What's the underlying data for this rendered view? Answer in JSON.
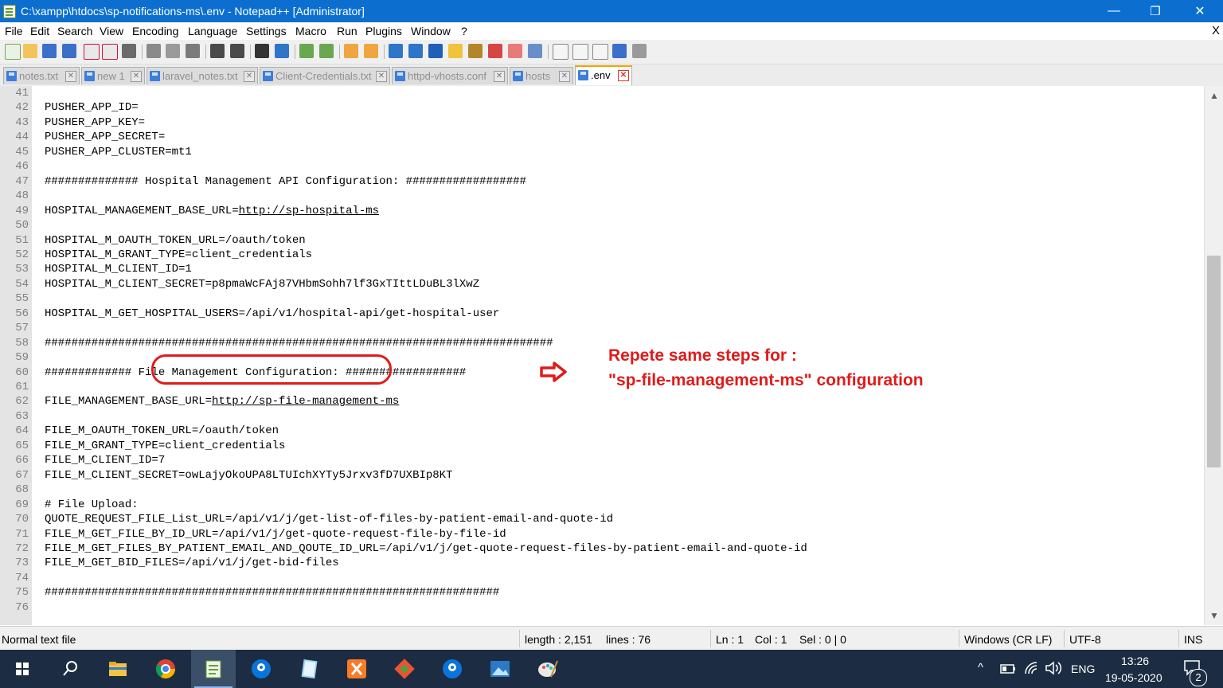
{
  "window": {
    "title": "C:\\xampp\\htdocs\\sp-notifications-ms\\.env - Notepad++ [Administrator]",
    "minimize": "—",
    "maximize": "❐",
    "close": "✕"
  },
  "menu": {
    "items": [
      "File",
      "Edit",
      "Search",
      "View",
      "Encoding",
      "Language",
      "Settings",
      "Macro",
      "Run",
      "Plugins",
      "Window",
      "?"
    ],
    "close_document": "X"
  },
  "tabs": [
    {
      "label": "notes.txt",
      "active": false
    },
    {
      "label": "new 1",
      "active": false
    },
    {
      "label": "laravel_notes.txt",
      "active": false
    },
    {
      "label": "Client-Credentials.txt",
      "active": false
    },
    {
      "label": "httpd-vhosts.conf",
      "active": false
    },
    {
      "label": "hosts",
      "active": false
    },
    {
      "label": ".env",
      "active": true
    }
  ],
  "tab_close_glyph": "✕",
  "editor": {
    "lines": [
      {
        "n": "41",
        "text": ""
      },
      {
        "n": "42",
        "text": "PUSHER_APP_ID="
      },
      {
        "n": "43",
        "text": "PUSHER_APP_KEY="
      },
      {
        "n": "44",
        "text": "PUSHER_APP_SECRET="
      },
      {
        "n": "45",
        "text": "PUSHER_APP_CLUSTER=mt1"
      },
      {
        "n": "46",
        "text": ""
      },
      {
        "n": "47",
        "text": "############## Hospital Management API Configuration: ##################"
      },
      {
        "n": "48",
        "text": ""
      },
      {
        "n": "49",
        "pre": "HOSPITAL_MANAGEMENT_BASE_URL=",
        "url": "http://sp-hospital-ms"
      },
      {
        "n": "50",
        "text": ""
      },
      {
        "n": "51",
        "text": "HOSPITAL_M_OAUTH_TOKEN_URL=/oauth/token"
      },
      {
        "n": "52",
        "text": "HOSPITAL_M_GRANT_TYPE=client_credentials"
      },
      {
        "n": "53",
        "text": "HOSPITAL_M_CLIENT_ID=1"
      },
      {
        "n": "54",
        "text": "HOSPITAL_M_CLIENT_SECRET=p8pmaWcFAj87VHbmSohh7lf3GxTIttLDuBL3lXwZ"
      },
      {
        "n": "55",
        "text": ""
      },
      {
        "n": "56",
        "text": "HOSPITAL_M_GET_HOSPITAL_USERS=/api/v1/hospital-api/get-hospital-user"
      },
      {
        "n": "57",
        "text": ""
      },
      {
        "n": "58",
        "text": "############################################################################"
      },
      {
        "n": "59",
        "text": ""
      },
      {
        "n": "60",
        "text": "############# File Management Configuration: ##################"
      },
      {
        "n": "61",
        "text": ""
      },
      {
        "n": "62",
        "pre": "FILE_MANAGEMENT_BASE_URL=",
        "url": "http://sp-file-management-ms"
      },
      {
        "n": "63",
        "text": ""
      },
      {
        "n": "64",
        "text": "FILE_M_OAUTH_TOKEN_URL=/oauth/token"
      },
      {
        "n": "65",
        "text": "FILE_M_GRANT_TYPE=client_credentials"
      },
      {
        "n": "66",
        "text": "FILE_M_CLIENT_ID=7"
      },
      {
        "n": "67",
        "text": "FILE_M_CLIENT_SECRET=owLajyOkoUPA8LTUIchXYTy5Jrxv3fD7UXBIp8KT"
      },
      {
        "n": "68",
        "text": ""
      },
      {
        "n": "69",
        "text": "# File Upload:"
      },
      {
        "n": "70",
        "text": "QUOTE_REQUEST_FILE_List_URL=/api/v1/j/get-list-of-files-by-patient-email-and-quote-id"
      },
      {
        "n": "71",
        "text": "FILE_M_GET_FILE_BY_ID_URL=/api/v1/j/get-quote-request-file-by-file-id"
      },
      {
        "n": "72",
        "text": "FILE_M_GET_FILES_BY_PATIENT_EMAIL_AND_QOUTE_ID_URL=/api/v1/j/get-quote-request-files-by-patient-email-and-quote-id"
      },
      {
        "n": "73",
        "text": "FILE_M_GET_BID_FILES=/api/v1/j/get-bid-files"
      },
      {
        "n": "74",
        "text": ""
      },
      {
        "n": "75",
        "text": "####################################################################"
      },
      {
        "n": "76",
        "text": ""
      }
    ]
  },
  "annotation": {
    "line1": "Repete same steps for :",
    "line2": "\"sp-file-management-ms\" configuration",
    "color": "#e01b1b"
  },
  "scrollbar": {
    "up": "▲",
    "down": "▼",
    "position": 0.52,
    "visible_fraction": 0.42
  },
  "status": {
    "file_type": "Normal text file",
    "length": "length : 2,151",
    "lines": "lines : 76",
    "ln": "Ln : 1",
    "col": "Col : 1",
    "sel": "Sel : 0 | 0",
    "eol": "Windows (CR LF)",
    "encoding": "UTF-8",
    "mode": "INS"
  },
  "taskbar": {
    "apps": [
      "start-icon",
      "search-icon",
      "file-explorer-icon",
      "chrome-icon",
      "notepadpp-icon",
      "maps-pin-icon",
      "notepad-icon",
      "xampp-icon",
      "git-icon",
      "maps-pin-icon-2",
      "photos-icon",
      "paint-icon"
    ],
    "tray_chevron": "^",
    "language": "ENG",
    "time": "13:26",
    "date": "19-05-2020",
    "notifications": "2"
  }
}
